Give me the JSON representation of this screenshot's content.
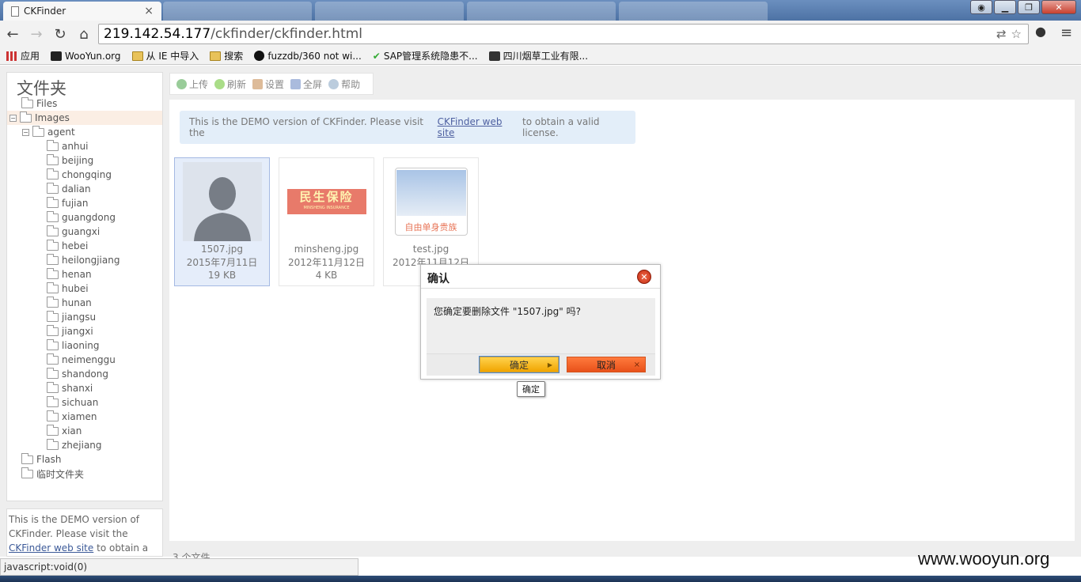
{
  "browser": {
    "active_tab_title": "CKFinder",
    "address_host": "219.142.54.177",
    "address_path": "/ckfinder/ckfinder.html",
    "bookmarks": [
      "应用",
      "WooYun.org",
      "从 IE 中导入",
      "搜索",
      "fuzzdb/360 not wi...",
      "SAP管理系统隐患不...",
      "四川烟草工业有限..."
    ],
    "status_url": "javascript:void(0)"
  },
  "sidebar": {
    "title": "文件夹",
    "tree": [
      {
        "label": "Files",
        "level": 1,
        "toggle": ""
      },
      {
        "label": "Images",
        "level": 1,
        "toggle": "−",
        "selected": true
      },
      {
        "label": "agent",
        "level": 2,
        "toggle": "−"
      },
      {
        "label": "anhui",
        "level": 3
      },
      {
        "label": "beijing",
        "level": 3
      },
      {
        "label": "chongqing",
        "level": 3
      },
      {
        "label": "dalian",
        "level": 3
      },
      {
        "label": "fujian",
        "level": 3
      },
      {
        "label": "guangdong",
        "level": 3
      },
      {
        "label": "guangxi",
        "level": 3
      },
      {
        "label": "hebei",
        "level": 3
      },
      {
        "label": "heilongjiang",
        "level": 3
      },
      {
        "label": "henan",
        "level": 3
      },
      {
        "label": "hubei",
        "level": 3
      },
      {
        "label": "hunan",
        "level": 3
      },
      {
        "label": "jiangsu",
        "level": 3
      },
      {
        "label": "jiangxi",
        "level": 3
      },
      {
        "label": "liaoning",
        "level": 3
      },
      {
        "label": "neimenggu",
        "level": 3
      },
      {
        "label": "shandong",
        "level": 3
      },
      {
        "label": "shanxi",
        "level": 3
      },
      {
        "label": "sichuan",
        "level": 3
      },
      {
        "label": "xiamen",
        "level": 3
      },
      {
        "label": "xian",
        "level": 3
      },
      {
        "label": "zhejiang",
        "level": 3
      },
      {
        "label": "Flash",
        "level": 1
      },
      {
        "label": "临时文件夹",
        "level": 1
      }
    ],
    "info_pre": "This is the DEMO version of CKFinder. Please visit the",
    "info_link": "CKFinder web site",
    "info_post": "to obtain a valid license."
  },
  "toolbar": {
    "upload": "上传",
    "refresh": "刷新",
    "settings": "设置",
    "fullscreen": "全屏",
    "help": "帮助"
  },
  "banner": {
    "pre": "This is the DEMO version of CKFinder. Please visit the",
    "link": "CKFinder web site",
    "post": "to obtain a valid license."
  },
  "files": [
    {
      "name": "1507.jpg",
      "date": "2015年7月11日",
      "size": "19 KB",
      "selected": true
    },
    {
      "name": "minsheng.jpg",
      "date": "2012年11月12日",
      "size": "4 KB",
      "logo_cn": "民生保险",
      "logo_en": "MINSHENG INSURANCE"
    },
    {
      "name": "test.jpg",
      "date": "2012年11月12日",
      "size": "",
      "caption": "自由单身贵族"
    }
  ],
  "status": "3 个文件",
  "dialog": {
    "title": "确认",
    "message": "您确定要删除文件 \"1507.jpg\" 吗?",
    "ok": "确定",
    "cancel": "取消",
    "tooltip": "确定"
  },
  "watermark": "www.wooyun.org",
  "colors": {
    "accent": "#4d5fa0",
    "ok": "#f0a400",
    "cancel": "#e8511a"
  }
}
